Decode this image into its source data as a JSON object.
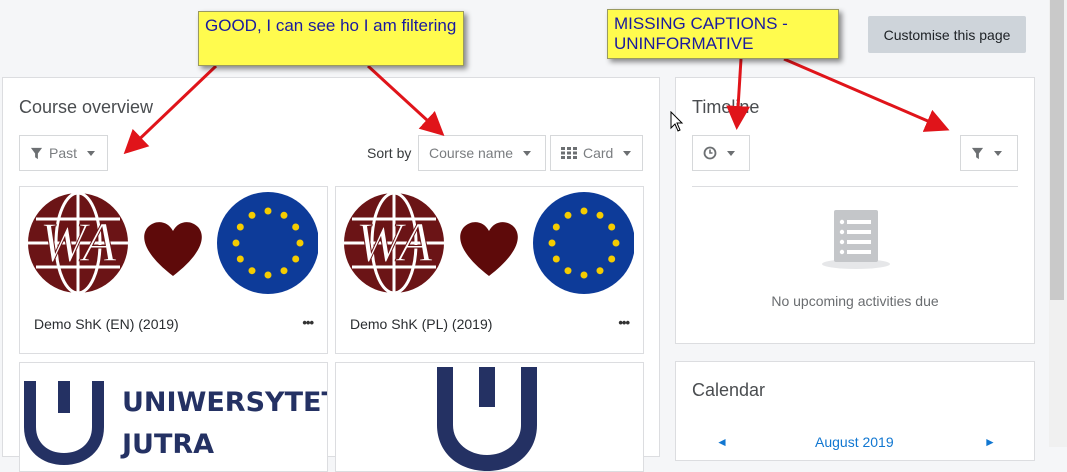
{
  "header": {
    "customise_label": "Customise this page"
  },
  "course_overview": {
    "title": "Course overview",
    "filter_label": "Past",
    "sort_by_label": "Sort by",
    "sort_value": "Course name",
    "view_value": "Card",
    "courses": [
      {
        "name": "Demo ShK (EN) (2019)",
        "more_label": "•••"
      },
      {
        "name": "Demo ShK (PL) (2019)",
        "more_label": "•••"
      },
      {
        "name": "",
        "logo_line1": "UNIWERSYTET",
        "logo_line2": "JUTRA"
      },
      {
        "name": ""
      }
    ],
    "wa_logo_text": "WA"
  },
  "timeline": {
    "title": "Timeline",
    "empty_text": "No upcoming activities due"
  },
  "calendar": {
    "title": "Calendar",
    "month": "August 2019"
  },
  "annotations": {
    "note1": "GOOD, I can see ho I am filtering",
    "note2": "MISSING CAPTIONS - UNINFORMATIVE"
  },
  "colors": {
    "wa_maroon": "#6b1416",
    "heart": "#5e0a0a",
    "eu_blue": "#0d3b99",
    "eu_star": "#f5cc00",
    "uj_navy": "#243163",
    "note_yellow": "#fffb4e",
    "arrow_red": "#e0141a"
  }
}
